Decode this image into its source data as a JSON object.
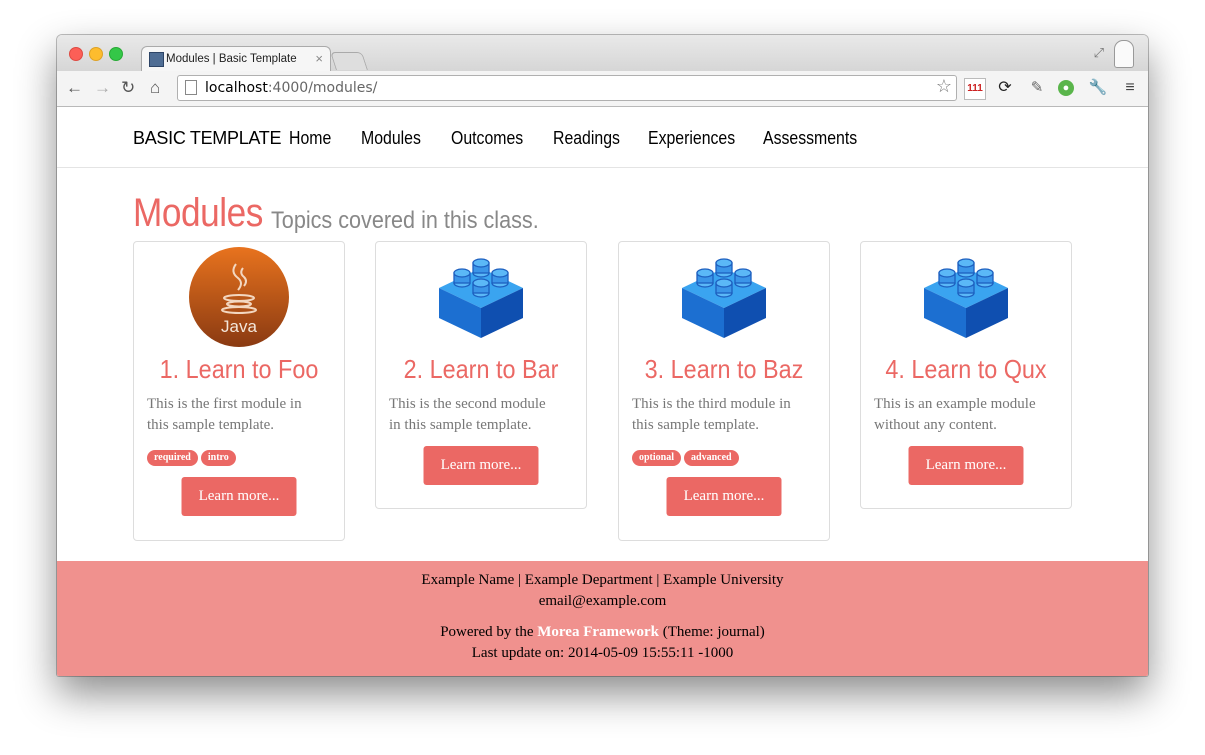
{
  "browser": {
    "tab_title": "Modules | Basic Template",
    "tab_close": "×",
    "url_host": "localhost",
    "url_rest": ":4000/modules/",
    "cal_badge": "111"
  },
  "nav": {
    "brand": "BASIC TEMPLATE",
    "links": [
      "Home",
      "Modules",
      "Outcomes",
      "Readings",
      "Experiences",
      "Assessments"
    ]
  },
  "header": {
    "title": "Modules",
    "subtitle": "Topics covered in this class."
  },
  "java_logo_text": "Java",
  "modules": [
    {
      "title": "1. Learn to Foo",
      "desc_line1": "This is the first module in",
      "desc_line2": "this sample template.",
      "tags": [
        "required",
        "intro"
      ],
      "button": "Learn more...",
      "icon": "java-logo"
    },
    {
      "title": "2. Learn to Bar",
      "desc_line1": "This is the second module",
      "desc_line2": "in this sample template.",
      "tags": [],
      "button": "Learn more...",
      "icon": "blocks-icon"
    },
    {
      "title": "3. Learn to Baz",
      "desc_line1": "This is the third module in",
      "desc_line2": "this sample template.",
      "tags": [
        "optional",
        "advanced"
      ],
      "button": "Learn more...",
      "icon": "blocks-icon"
    },
    {
      "title": "4. Learn to Qux",
      "desc_line1": "This is an example module",
      "desc_line2": "without any content.",
      "tags": [],
      "button": "Learn more...",
      "icon": "blocks-icon"
    }
  ],
  "footer": {
    "line1": "Example Name | Example Department | Example University",
    "line2": "email@example.com",
    "powered_prefix": "Powered by the ",
    "framework_link": "Morea Framework",
    "powered_suffix": " (Theme: journal)",
    "last_update": "Last update on: 2014-05-09 15:55:11 -1000"
  },
  "colors": {
    "accent": "#eb6864",
    "footer_bg": "#f0918e"
  }
}
